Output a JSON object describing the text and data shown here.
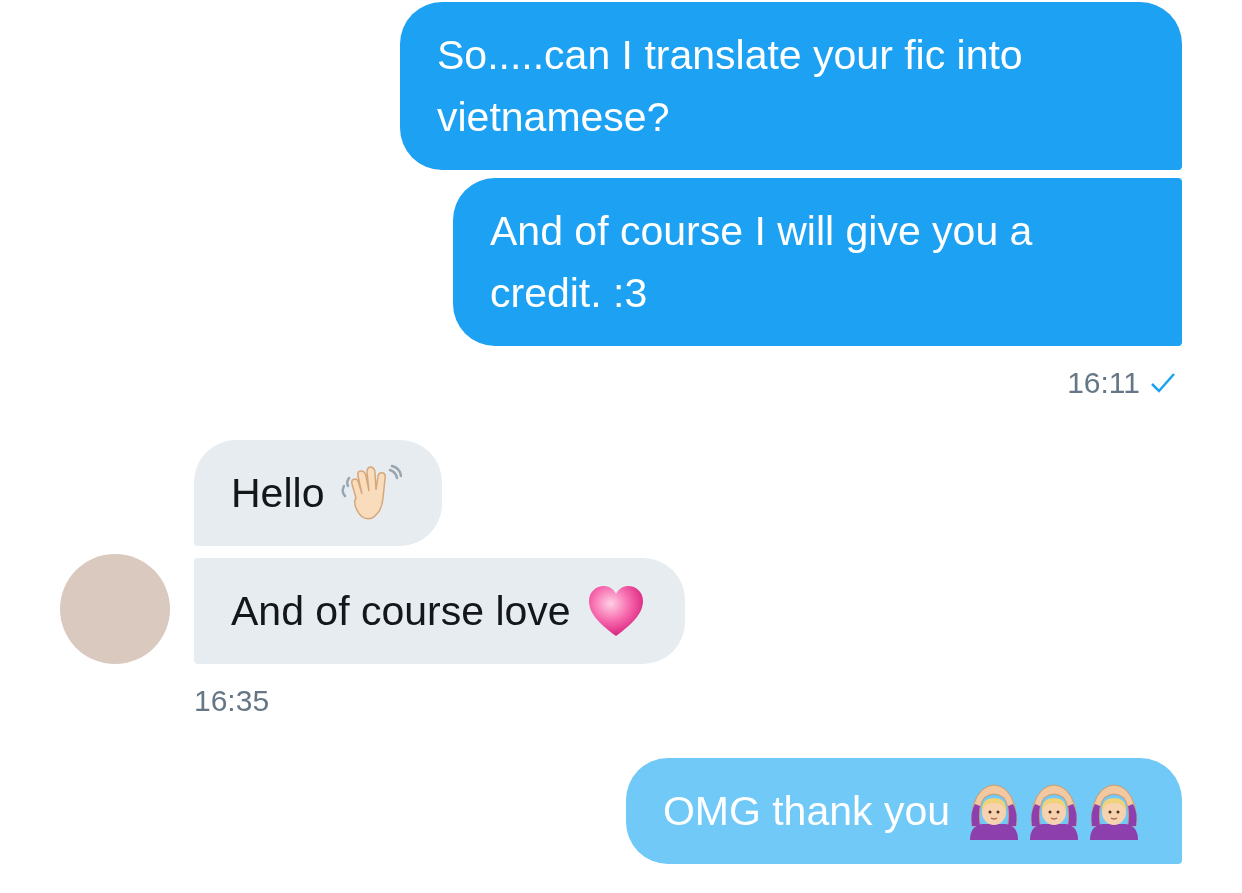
{
  "conversation": [
    {
      "kind": "outgoing",
      "messages": [
        {
          "text": "So.....can I translate your fic into vietnamese?",
          "delivered": true
        },
        {
          "text": "And of course I will give you a credit. :3",
          "delivered": true
        }
      ],
      "time": "16:11",
      "sent": true
    },
    {
      "kind": "incoming",
      "messages": [
        {
          "text": "Hello",
          "emojis": [
            {
              "kind": "waving-hand"
            }
          ]
        },
        {
          "text": "And of course love",
          "emojis": [
            {
              "kind": "heart"
            }
          ]
        }
      ],
      "time": "16:35"
    },
    {
      "kind": "outgoing",
      "messages": [
        {
          "text": "OMG thank you",
          "delivered": false,
          "emojis": [
            {
              "kind": "person-arms-up"
            },
            {
              "kind": "person-arms-up"
            },
            {
              "kind": "person-arms-up"
            }
          ]
        }
      ],
      "sent": false
    }
  ]
}
